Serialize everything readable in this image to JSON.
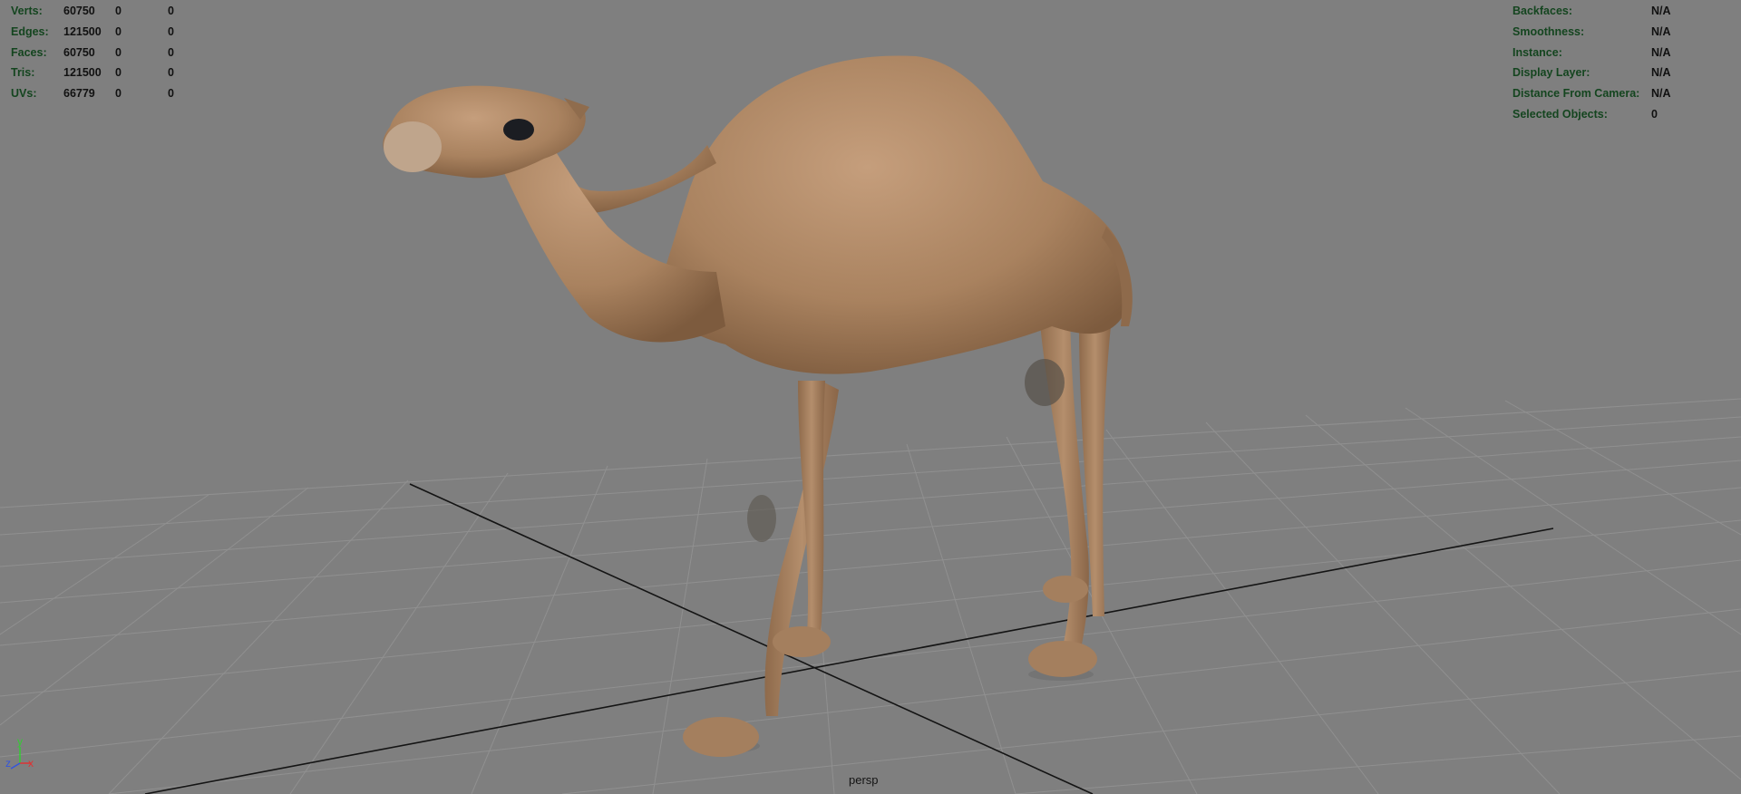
{
  "viewport": {
    "camera_label": "persp"
  },
  "stats_left": {
    "rows": [
      {
        "label": "Verts:",
        "values": [
          "60750",
          "0",
          "0"
        ]
      },
      {
        "label": "Edges:",
        "values": [
          "121500",
          "0",
          "0"
        ]
      },
      {
        "label": "Faces:",
        "values": [
          "60750",
          "0",
          "0"
        ]
      },
      {
        "label": "Tris:",
        "values": [
          "121500",
          "0",
          "0"
        ]
      },
      {
        "label": "UVs:",
        "values": [
          "66779",
          "0",
          "0"
        ]
      }
    ]
  },
  "stats_right": {
    "rows": [
      {
        "label": "Backfaces:",
        "value": "N/A"
      },
      {
        "label": "Smoothness:",
        "value": "N/A"
      },
      {
        "label": "Instance:",
        "value": "N/A"
      },
      {
        "label": "Display Layer:",
        "value": "N/A"
      },
      {
        "label": "Distance From Camera:",
        "value": "N/A"
      },
      {
        "label": "Selected Objects:",
        "value": "0"
      }
    ]
  },
  "axis_gizmo": {
    "y": "y",
    "z": "z",
    "x": "x"
  },
  "colors": {
    "background": "#7f7f7f",
    "grid": "#939393",
    "axis_lines": "#141414",
    "hud_label": "#14451f",
    "hud_value": "#111111",
    "camel_body": "#b08a67"
  },
  "model": {
    "name_icon": "camel-model"
  }
}
